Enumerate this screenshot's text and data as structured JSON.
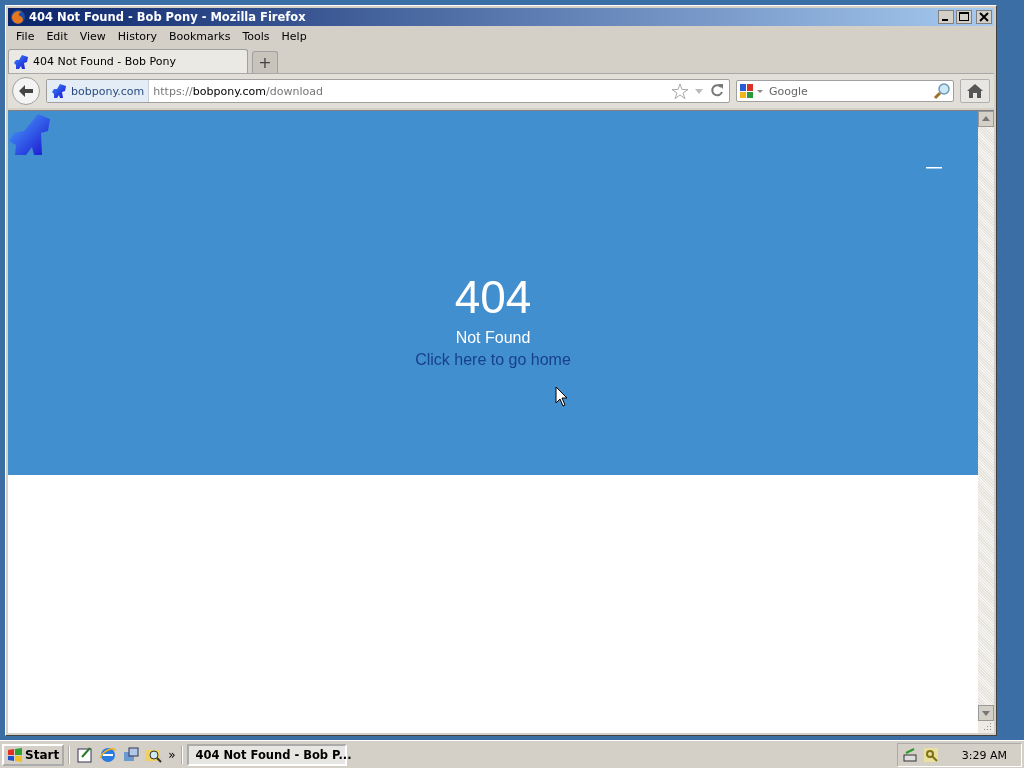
{
  "window": {
    "title": "404 Not Found - Bob Pony - Mozilla Firefox"
  },
  "menu": [
    "File",
    "Edit",
    "View",
    "History",
    "Bookmarks",
    "Tools",
    "Help"
  ],
  "tabs": [
    {
      "label": "404 Not Found - Bob Pony",
      "selected": true
    }
  ],
  "new_tab": "+",
  "address_bar": {
    "identity": "bobpony.com",
    "url": [
      {
        "text": "https://",
        "kind": "dim"
      },
      {
        "text": "bobpony.com",
        "kind": "domain"
      },
      {
        "text": "/download",
        "kind": "dim"
      }
    ]
  },
  "search": {
    "placeholder": "Google"
  },
  "page": {
    "code": "404",
    "message": "Not Found",
    "link": "Click here to go home"
  },
  "taskbar": {
    "start": "Start",
    "more": "»",
    "tasks": [
      {
        "label": "404 Not Found - Bob P...",
        "selected": true
      }
    ],
    "clock": "3:29 AM"
  }
}
